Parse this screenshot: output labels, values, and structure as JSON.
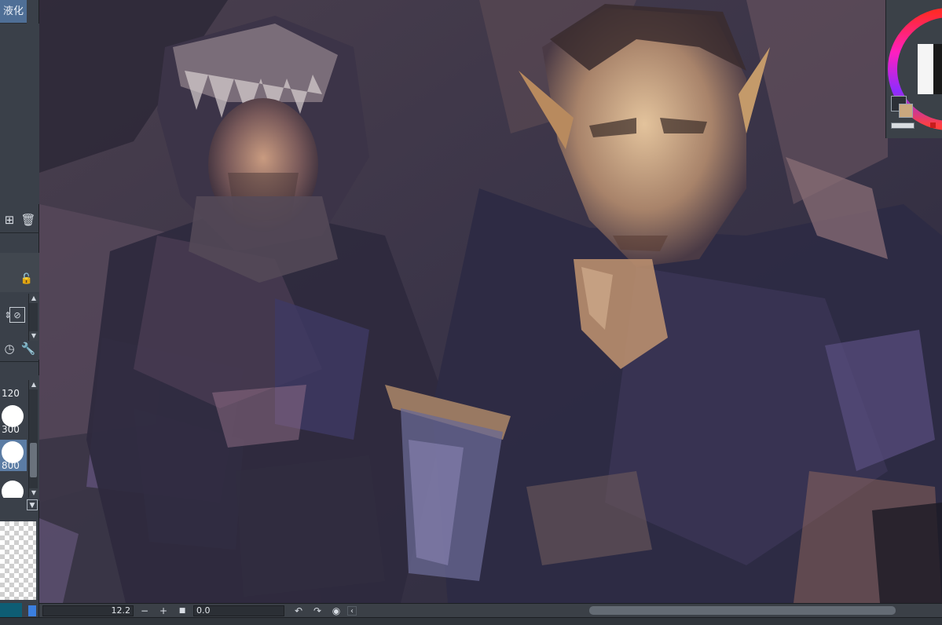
{
  "left_panel": {
    "tab_label": "液化",
    "brush_sizes": [
      "120",
      "300",
      "800"
    ],
    "selected_brush": "800"
  },
  "status_bar": {
    "zoom_value": "12.2",
    "rotation_value": "0.0"
  },
  "colors": {
    "main_color": "#2b2f36",
    "sub_color": "#c9a77e",
    "accent_blue": "#4f6f96"
  },
  "icons": [
    "new-layer-icon",
    "trash-icon",
    "lock-icon",
    "mask-icon",
    "timer-icon",
    "wrench-icon",
    "minus-icon",
    "plus-icon",
    "stop-icon",
    "undo-rotate-icon",
    "redo-rotate-icon",
    "reset-rotate-icon",
    "chevron-left-icon"
  ]
}
